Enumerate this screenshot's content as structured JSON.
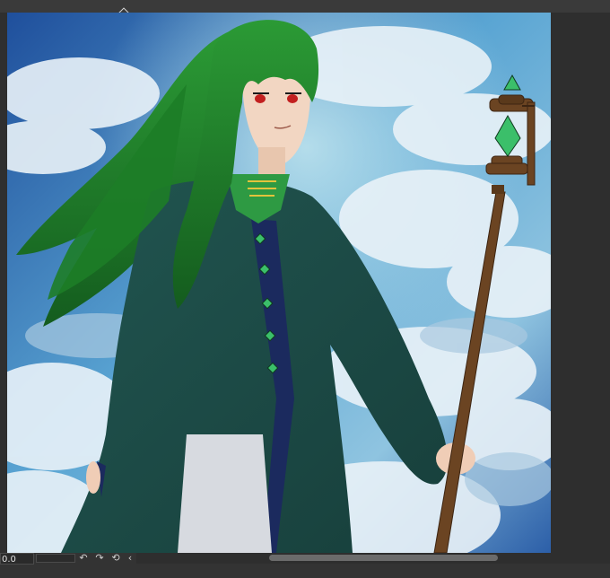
{
  "window": {
    "zoom_value": "0.0",
    "buttons": {
      "rotate_left_icon": "↶",
      "rotate_right_icon": "↷",
      "reset_icon": "⟲",
      "chevron_icon": "‹"
    }
  },
  "colors": {
    "ui_dark": "#3b3b3b",
    "sky_deep": "#2f5ea8",
    "robe": "#1d4a45",
    "hair": "#1f7a2a",
    "accent_gem": "#3bbf6a",
    "trim": "#1b2a5e"
  }
}
